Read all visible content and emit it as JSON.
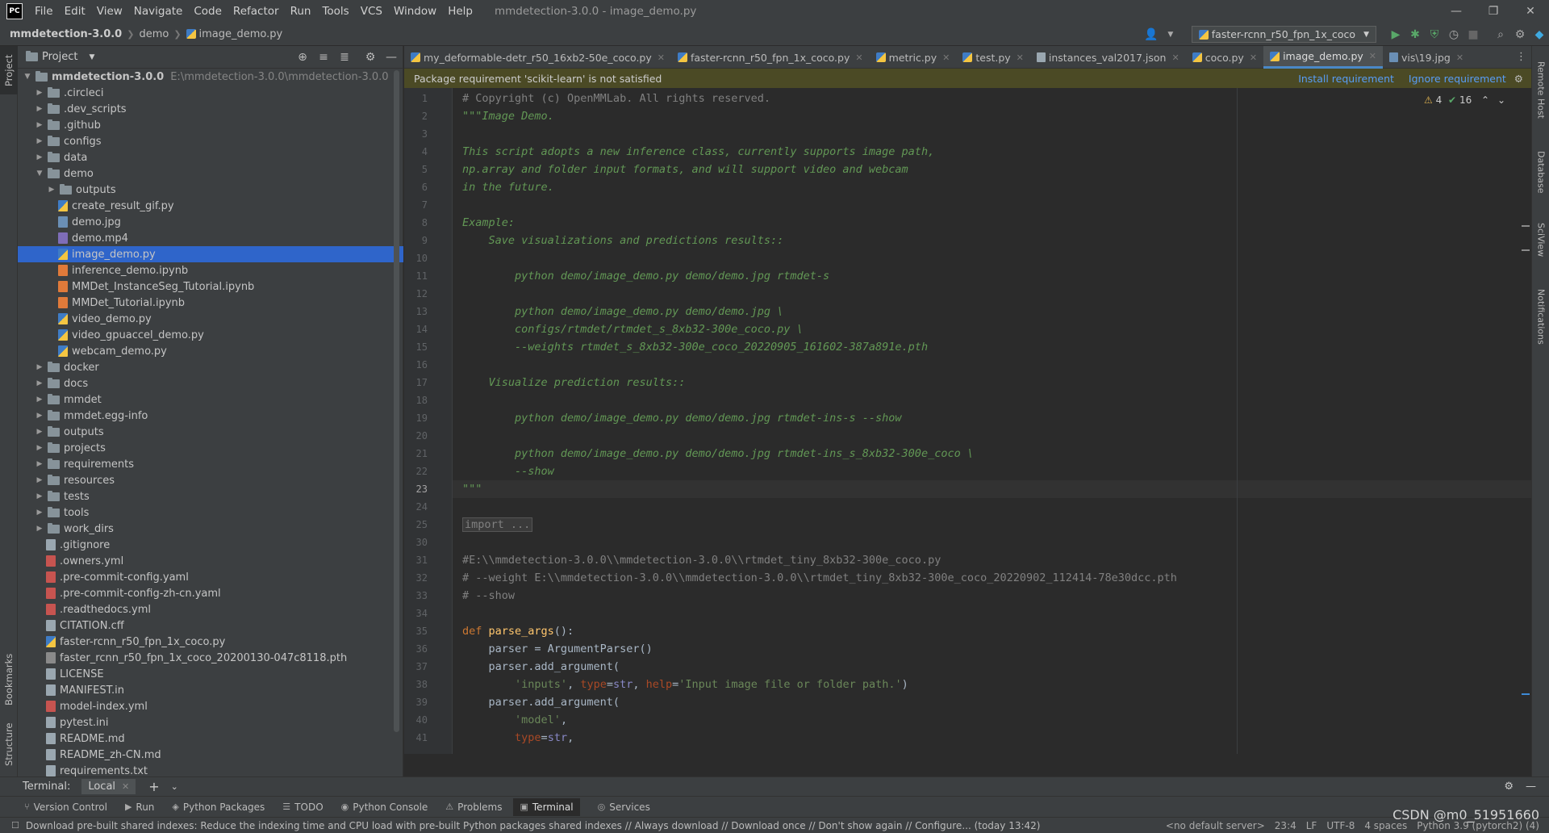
{
  "menubar": {
    "logo": "PC",
    "items": [
      "File",
      "Edit",
      "View",
      "Navigate",
      "Code",
      "Refactor",
      "Run",
      "Tools",
      "VCS",
      "Window",
      "Help"
    ],
    "title": "mmdetection-3.0.0 - image_demo.py"
  },
  "navbar": {
    "project": "mmdetection-3.0.0",
    "folder": "demo",
    "file": "image_demo.py",
    "run_config": "faster-rcnn_r50_fpn_1x_coco"
  },
  "left_tabs": {
    "project": "Project",
    "bookmarks": "Bookmarks",
    "structure": "Structure"
  },
  "right_tabs": {
    "remote": "Remote Host",
    "database": "Database",
    "sciview": "SciView",
    "notifications": "Notifications"
  },
  "project_panel": {
    "title": "Project"
  },
  "tree": [
    {
      "depth": 0,
      "type": "folder",
      "open": true,
      "name": "mmdetection-3.0.0",
      "path": "E:\\mmdetection-3.0.0\\mmdetection-3.0.0",
      "bold": true
    },
    {
      "depth": 1,
      "type": "folder",
      "name": ".circleci"
    },
    {
      "depth": 1,
      "type": "folder",
      "name": ".dev_scripts"
    },
    {
      "depth": 1,
      "type": "folder",
      "name": ".github"
    },
    {
      "depth": 1,
      "type": "folder",
      "name": "configs"
    },
    {
      "depth": 1,
      "type": "folder",
      "name": "data"
    },
    {
      "depth": 1,
      "type": "folder",
      "open": true,
      "name": "demo"
    },
    {
      "depth": 2,
      "type": "folder",
      "name": "outputs"
    },
    {
      "depth": 2,
      "type": "py",
      "name": "create_result_gif.py"
    },
    {
      "depth": 2,
      "type": "img",
      "name": "demo.jpg"
    },
    {
      "depth": 2,
      "type": "mp4",
      "name": "demo.mp4"
    },
    {
      "depth": 2,
      "type": "py",
      "name": "image_demo.py",
      "selected": true
    },
    {
      "depth": 2,
      "type": "nb",
      "name": "inference_demo.ipynb"
    },
    {
      "depth": 2,
      "type": "nb",
      "name": "MMDet_InstanceSeg_Tutorial.ipynb"
    },
    {
      "depth": 2,
      "type": "nb",
      "name": "MMDet_Tutorial.ipynb"
    },
    {
      "depth": 2,
      "type": "py",
      "name": "video_demo.py"
    },
    {
      "depth": 2,
      "type": "py",
      "name": "video_gpuaccel_demo.py"
    },
    {
      "depth": 2,
      "type": "py",
      "name": "webcam_demo.py"
    },
    {
      "depth": 1,
      "type": "folder",
      "name": "docker"
    },
    {
      "depth": 1,
      "type": "folder",
      "name": "docs"
    },
    {
      "depth": 1,
      "type": "folder",
      "name": "mmdet"
    },
    {
      "depth": 1,
      "type": "folder",
      "name": "mmdet.egg-info"
    },
    {
      "depth": 1,
      "type": "folder",
      "name": "outputs"
    },
    {
      "depth": 1,
      "type": "folder",
      "name": "projects"
    },
    {
      "depth": 1,
      "type": "folder",
      "name": "requirements"
    },
    {
      "depth": 1,
      "type": "folder",
      "name": "resources"
    },
    {
      "depth": 1,
      "type": "folder",
      "name": "tests"
    },
    {
      "depth": 1,
      "type": "folder",
      "name": "tools"
    },
    {
      "depth": 1,
      "type": "folder",
      "name": "work_dirs"
    },
    {
      "depth": 1,
      "type": "txt",
      "name": ".gitignore",
      "leaf": true
    },
    {
      "depth": 1,
      "type": "yml",
      "name": ".owners.yml",
      "leaf": true
    },
    {
      "depth": 1,
      "type": "yml",
      "name": ".pre-commit-config.yaml",
      "leaf": true
    },
    {
      "depth": 1,
      "type": "yml",
      "name": ".pre-commit-config-zh-cn.yaml",
      "leaf": true
    },
    {
      "depth": 1,
      "type": "yml",
      "name": ".readthedocs.yml",
      "leaf": true
    },
    {
      "depth": 1,
      "type": "txt",
      "name": "CITATION.cff",
      "leaf": true
    },
    {
      "depth": 1,
      "type": "py",
      "name": "faster-rcnn_r50_fpn_1x_coco.py",
      "leaf": true
    },
    {
      "depth": 1,
      "type": "pth",
      "name": "faster_rcnn_r50_fpn_1x_coco_20200130-047c8118.pth",
      "leaf": true
    },
    {
      "depth": 1,
      "type": "txt",
      "name": "LICENSE",
      "leaf": true
    },
    {
      "depth": 1,
      "type": "txt",
      "name": "MANIFEST.in",
      "leaf": true
    },
    {
      "depth": 1,
      "type": "yml",
      "name": "model-index.yml",
      "leaf": true
    },
    {
      "depth": 1,
      "type": "txt",
      "name": "pytest.ini",
      "leaf": true
    },
    {
      "depth": 1,
      "type": "txt",
      "name": "README.md",
      "leaf": true
    },
    {
      "depth": 1,
      "type": "txt",
      "name": "README_zh-CN.md",
      "leaf": true
    },
    {
      "depth": 1,
      "type": "txt",
      "name": "requirements.txt",
      "leaf": true
    }
  ],
  "tabs": [
    {
      "name": "my_deformable-detr_r50_16xb2-50e_coco.py",
      "icon": "py"
    },
    {
      "name": "faster-rcnn_r50_fpn_1x_coco.py",
      "icon": "py"
    },
    {
      "name": "metric.py",
      "icon": "py"
    },
    {
      "name": "test.py",
      "icon": "py"
    },
    {
      "name": "instances_val2017.json",
      "icon": "json"
    },
    {
      "name": "coco.py",
      "icon": "py"
    },
    {
      "name": "image_demo.py",
      "icon": "py",
      "active": true
    },
    {
      "name": "vis\\19.jpg",
      "icon": "img"
    }
  ],
  "banner": {
    "text": "Package requirement 'scikit-learn' is not satisfied",
    "install": "Install requirement",
    "ignore": "Ignore requirement"
  },
  "inspections": {
    "warnings": "4",
    "ok": "16"
  },
  "current_line": 23,
  "code": [
    {
      "n": "1",
      "segs": [
        [
          "com",
          "# Copyright (c) OpenMMLab. All rights reserved."
        ]
      ]
    },
    {
      "n": "2",
      "segs": [
        [
          "doc",
          "\"\"\"Image Demo."
        ]
      ]
    },
    {
      "n": "3",
      "segs": []
    },
    {
      "n": "4",
      "segs": [
        [
          "doc",
          "This script adopts a new inference class, currently supports image path,"
        ]
      ]
    },
    {
      "n": "5",
      "segs": [
        [
          "doc",
          "np.array and folder input formats, and will support video and webcam"
        ]
      ]
    },
    {
      "n": "6",
      "segs": [
        [
          "doc",
          "in the future."
        ]
      ]
    },
    {
      "n": "7",
      "segs": []
    },
    {
      "n": "8",
      "segs": [
        [
          "doc",
          "Example:"
        ]
      ]
    },
    {
      "n": "9",
      "segs": [
        [
          "doc",
          "    Save visualizations and predictions results::"
        ]
      ]
    },
    {
      "n": "10",
      "segs": []
    },
    {
      "n": "11",
      "segs": [
        [
          "doc",
          "        python demo/image_demo.py demo/demo.jpg rtmdet-s"
        ]
      ]
    },
    {
      "n": "12",
      "segs": []
    },
    {
      "n": "13",
      "segs": [
        [
          "doc",
          "        python demo/image_demo.py demo/demo.jpg \\"
        ]
      ]
    },
    {
      "n": "14",
      "segs": [
        [
          "doc",
          "        configs/rtmdet/rtmdet_s_8xb32-300e_coco.py \\"
        ]
      ]
    },
    {
      "n": "15",
      "segs": [
        [
          "doc",
          "        --weights rtmdet_s_8xb32-300e_coco_20220905_161602-387a891e.pth"
        ]
      ]
    },
    {
      "n": "16",
      "segs": []
    },
    {
      "n": "17",
      "segs": [
        [
          "doc",
          "    Visualize prediction results::"
        ]
      ]
    },
    {
      "n": "18",
      "segs": []
    },
    {
      "n": "19",
      "segs": [
        [
          "doc",
          "        python demo/image_demo.py demo/demo.jpg rtmdet-ins-s --show"
        ]
      ]
    },
    {
      "n": "20",
      "segs": []
    },
    {
      "n": "21",
      "segs": [
        [
          "doc",
          "        python demo/image_demo.py demo/demo.jpg rtmdet-ins_s_8xb32-300e_coco \\"
        ]
      ]
    },
    {
      "n": "22",
      "segs": [
        [
          "doc",
          "        --show"
        ]
      ]
    },
    {
      "n": "23",
      "segs": [
        [
          "doc",
          "\"\"\""
        ]
      ]
    },
    {
      "n": "24",
      "segs": []
    },
    {
      "n": "25",
      "segs": [
        [
          "fold",
          "import ..."
        ]
      ]
    },
    {
      "n": "30",
      "segs": []
    },
    {
      "n": "31",
      "segs": [
        [
          "com",
          "#E:\\\\mmdetection-3.0.0\\\\mmdetection-3.0.0\\\\rtmdet_tiny_8xb32-300e_coco.py"
        ]
      ]
    },
    {
      "n": "32",
      "segs": [
        [
          "com",
          "# --weight E:\\\\mmdetection-3.0.0\\\\mmdetection-3.0.0\\\\rtmdet_tiny_8xb32-300e_coco_20220902_112414-78e30dcc.pth"
        ]
      ]
    },
    {
      "n": "33",
      "segs": [
        [
          "com",
          "# --show"
        ]
      ]
    },
    {
      "n": "34",
      "segs": []
    },
    {
      "n": "35",
      "segs": [
        [
          "kw",
          "def "
        ],
        [
          "fn",
          "parse_args"
        ],
        [
          "def",
          "():"
        ]
      ]
    },
    {
      "n": "36",
      "segs": [
        [
          "def",
          "    parser = ArgumentParser()"
        ]
      ]
    },
    {
      "n": "37",
      "segs": [
        [
          "def",
          "    parser.add_argument("
        ]
      ]
    },
    {
      "n": "38",
      "segs": [
        [
          "def",
          "        "
        ],
        [
          "str",
          "'inputs'"
        ],
        [
          "def",
          ", "
        ],
        [
          "par",
          "type"
        ],
        [
          "def",
          "="
        ],
        [
          "bi",
          "str"
        ],
        [
          "def",
          ", "
        ],
        [
          "par",
          "help"
        ],
        [
          "def",
          "="
        ],
        [
          "str",
          "'Input image file or folder path.'"
        ],
        [
          "def",
          ")"
        ]
      ]
    },
    {
      "n": "39",
      "segs": [
        [
          "def",
          "    parser.add_argument("
        ]
      ]
    },
    {
      "n": "40",
      "segs": [
        [
          "def",
          "        "
        ],
        [
          "str",
          "'model'"
        ],
        [
          "def",
          ","
        ]
      ]
    },
    {
      "n": "41",
      "segs": [
        [
          "def",
          "        "
        ],
        [
          "par",
          "type"
        ],
        [
          "def",
          "="
        ],
        [
          "bi",
          "str"
        ],
        [
          "def",
          ","
        ]
      ]
    }
  ],
  "terminal": {
    "label": "Terminal:",
    "tab": "Local"
  },
  "toolwindows": [
    {
      "icon": "⑂",
      "label": "Version Control"
    },
    {
      "icon": "▶",
      "label": "Run"
    },
    {
      "icon": "◈",
      "label": "Python Packages"
    },
    {
      "icon": "☰",
      "label": "TODO"
    },
    {
      "icon": "◉",
      "label": "Python Console"
    },
    {
      "icon": "⚠",
      "label": "Problems"
    },
    {
      "icon": "▣",
      "label": "Terminal",
      "active": true
    },
    {
      "icon": "◎",
      "label": "Services"
    }
  ],
  "status": {
    "message": "Download pre-built shared indexes: Reduce the indexing time and CPU load with pre-built Python packages shared indexes // Always download // Download once // Don't show again // Configure... (today 13:42)",
    "server": "<no default server>",
    "position": "23:4",
    "eol": "LF",
    "encoding": "UTF-8",
    "indent": "4 spaces",
    "interpreter": "Python 3.9 (pytorch2) (4)"
  },
  "watermark": "CSDN @m0_51951660"
}
